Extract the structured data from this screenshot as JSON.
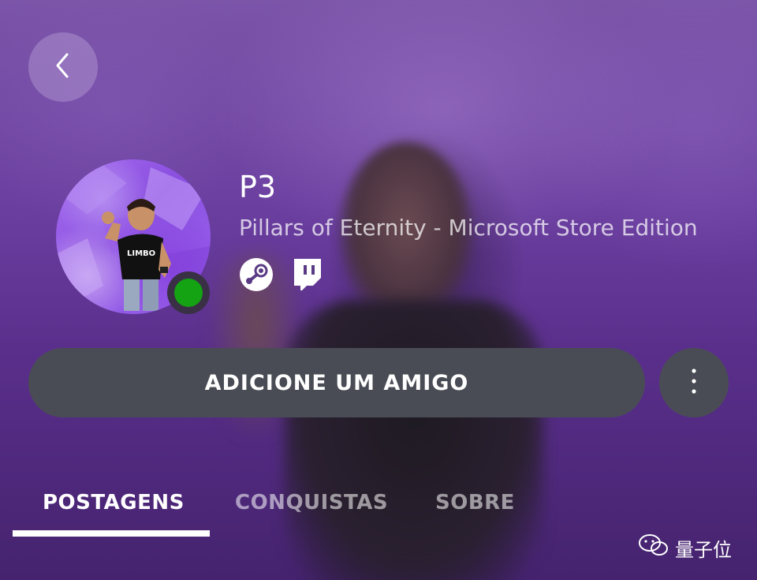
{
  "profile": {
    "gamertag": "P3",
    "now_playing": "Pillars of Eternity - Microsoft Store Edition",
    "presence": "online",
    "avatar_shirt_text": "LIMBO"
  },
  "social_links": [
    {
      "name": "steam",
      "icon": "steam-icon"
    },
    {
      "name": "twitch",
      "icon": "twitch-icon"
    }
  ],
  "actions": {
    "add_friend_label": "ADICIONE UM AMIGO",
    "more_icon": "more-vertical-icon",
    "back_icon": "back-chevron-icon"
  },
  "tabs": [
    {
      "label": "POSTAGENS",
      "active": true
    },
    {
      "label": "CONQUISTAS",
      "active": false
    },
    {
      "label": "SOBRE",
      "active": false
    }
  ],
  "watermark": {
    "text": "量子位",
    "icon": "wechat-icon"
  },
  "colors": {
    "background": "#6b3fa0",
    "button": "#4a4c55",
    "online": "#13a313",
    "avatar_bg": "#9b63ee"
  }
}
